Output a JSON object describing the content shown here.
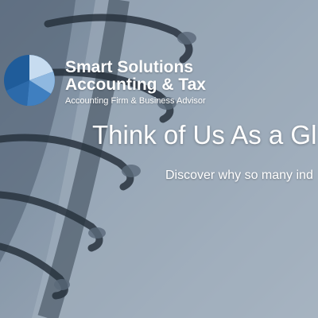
{
  "brand": {
    "name_line1": "Smart Solutions",
    "name_line2": "Accounting & Tax",
    "tagline": "Accounting Firm & Business Advisor",
    "colors": {
      "mark_dark": "#1f5c9a",
      "mark_mid": "#3f7fc0",
      "mark_light": "#8fb8e0",
      "mark_pale": "#c7dcf0"
    }
  },
  "hero": {
    "headline": "Think of Us As a Gl",
    "subheadline": "Discover why so many ind",
    "background_icon": "spiral-notebook-image"
  }
}
